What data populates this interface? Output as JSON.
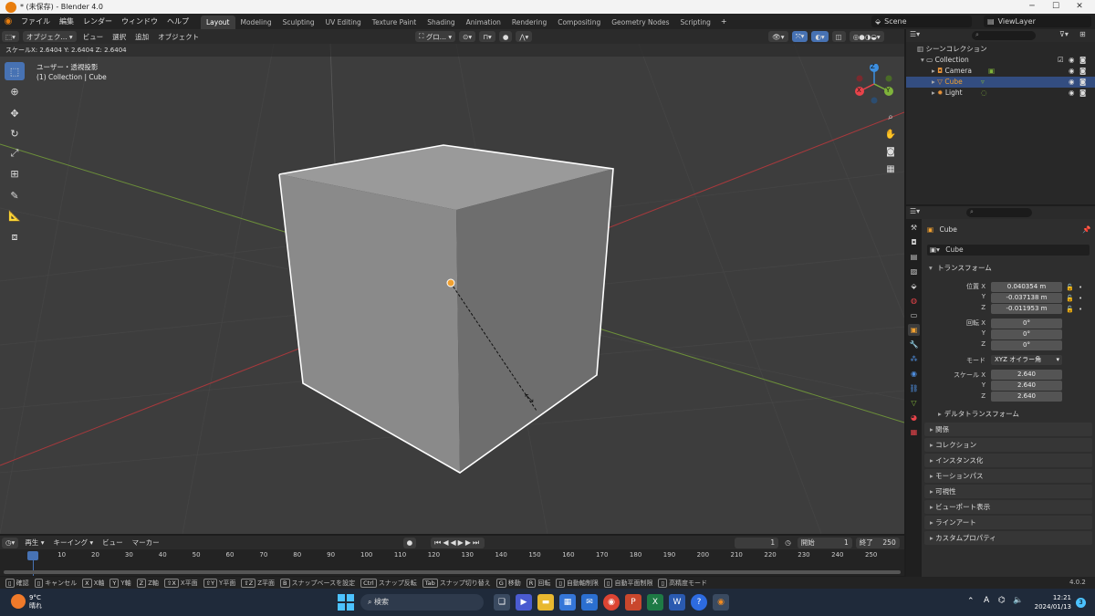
{
  "window": {
    "title": "* (未保存) - Blender 4.0",
    "min": "─",
    "max": "☐",
    "close": "✕"
  },
  "menu": [
    "ファイル",
    "編集",
    "レンダー",
    "ウィンドウ",
    "ヘルプ"
  ],
  "workspaces": [
    "Layout",
    "Modeling",
    "Sculpting",
    "UV Editing",
    "Texture Paint",
    "Shading",
    "Animation",
    "Rendering",
    "Compositing",
    "Geometry Nodes",
    "Scripting"
  ],
  "active_workspace": "Layout",
  "add_workspace": "+",
  "scene": "Scene",
  "viewlayer": "ViewLayer",
  "viewport_header": {
    "mode": "オブジェク...",
    "view": "ビュー",
    "select": "選択",
    "add": "追加",
    "object": "オブジェクト",
    "orientation": "グロ..."
  },
  "viewport": {
    "scale_readout": "スケールX: 2.6404   Y: 2.6404   Z: 2.6404",
    "view_name": "ユーザー・透視投影",
    "collection_label": "(1) Collection | Cube",
    "gizmo": {
      "x": "X",
      "y": "Y",
      "z": "Z"
    }
  },
  "outliner": {
    "title": "シーンコレクション",
    "items": [
      {
        "name": "Collection",
        "level": 1
      },
      {
        "name": "Camera",
        "level": 2
      },
      {
        "name": "Cube",
        "level": 2,
        "selected": true
      },
      {
        "name": "Light",
        "level": 2
      }
    ]
  },
  "properties": {
    "object_name": "Cube",
    "data_name": "Cube",
    "transform_title": "トランスフォーム",
    "location_label": "位置 X",
    "location": {
      "x": "0.040354 m",
      "y": "-0.037138 m",
      "z": "-0.011953 m"
    },
    "rotation_label": "回転 X",
    "rotation": {
      "x": "0°",
      "y": "0°",
      "z": "0°"
    },
    "mode_label": "モード",
    "mode_value": "XYZ オイラー角",
    "scale_label": "スケール X",
    "scale": {
      "x": "2.640",
      "y": "2.640",
      "z": "2.640"
    },
    "axis_y": "Y",
    "axis_z": "Z",
    "panels": [
      "デルタトランスフォーム",
      "関係",
      "コレクション",
      "インスタンス化",
      "モーションパス",
      "可視性",
      "ビューポート表示",
      "ラインアート",
      "カスタムプロパティ"
    ]
  },
  "timeline": {
    "play": "再生",
    "keying": "キーイング",
    "view": "ビュー",
    "marker": "マーカー",
    "current_frame": "1",
    "start_label": "開始",
    "start": "1",
    "end_label": "終了",
    "end": "250",
    "ticks": [
      "1",
      "10",
      "20",
      "30",
      "40",
      "50",
      "60",
      "70",
      "80",
      "90",
      "100",
      "110",
      "120",
      "130",
      "140",
      "150",
      "160",
      "170",
      "180",
      "190",
      "200",
      "210",
      "220",
      "230",
      "240",
      "250"
    ]
  },
  "statusbar": [
    {
      "key": "",
      "label": "確認"
    },
    {
      "key": "",
      "label": "キャンセル"
    },
    {
      "key": "X",
      "label": "X軸"
    },
    {
      "key": "Y",
      "label": "Y軸"
    },
    {
      "key": "Z",
      "label": "Z軸"
    },
    {
      "key": "⇧X",
      "label": "X平面"
    },
    {
      "key": "⇧Y",
      "label": "Y平面"
    },
    {
      "key": "⇧Z",
      "label": "Z平面"
    },
    {
      "key": "B",
      "label": "スナップベースを設定"
    },
    {
      "key": "Ctrl",
      "label": "スナップ反転"
    },
    {
      "key": "Tab",
      "label": "スナップ切り替え"
    },
    {
      "key": "G",
      "label": "移動"
    },
    {
      "key": "R",
      "label": "回転"
    },
    {
      "key": "",
      "label": "自動軸制限"
    },
    {
      "key": "",
      "label": "自動平面制限"
    },
    {
      "key": "",
      "label": "高精度モード"
    }
  ],
  "version": "4.0.2",
  "taskbar": {
    "weather_temp": "9°C",
    "weather_text": "晴れ",
    "search": "検索",
    "time": "12:21",
    "date": "2024/01/13",
    "ime": "A",
    "notif": "3"
  },
  "colors": {
    "accent": "#4772b3",
    "selection": "#334d80",
    "x_axis": "#e8434a",
    "y_axis": "#7fb33b",
    "z_axis": "#3d8fe0"
  }
}
